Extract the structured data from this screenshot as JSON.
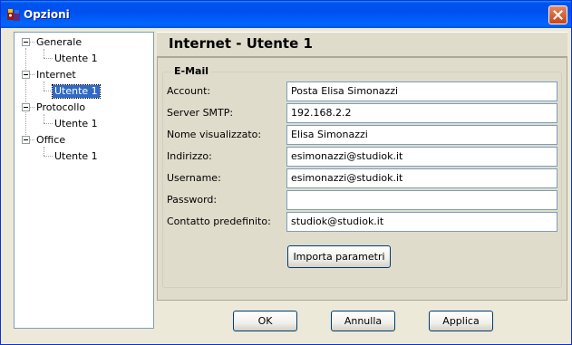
{
  "window": {
    "title": "Opzioni",
    "icon": "app-icon",
    "close_icon": "close-icon"
  },
  "tree": {
    "nodes": [
      {
        "label": "Generale",
        "children": [
          {
            "label": "Utente  1"
          }
        ]
      },
      {
        "label": "Internet",
        "children": [
          {
            "label": "Utente  1",
            "selected": true
          }
        ]
      },
      {
        "label": "Protocollo",
        "children": [
          {
            "label": "Utente  1"
          }
        ]
      },
      {
        "label": "Office",
        "children": [
          {
            "label": "Utente  1"
          }
        ]
      }
    ]
  },
  "panel": {
    "title": "Internet - Utente  1",
    "group_title": "E-Mail",
    "fields": [
      {
        "label": "Account:",
        "value": "Posta Elisa Simonazzi"
      },
      {
        "label": "Server SMTP:",
        "value": "192.168.2.2"
      },
      {
        "label": "Nome visualizzato:",
        "value": "Elisa Simonazzi"
      },
      {
        "label": "Indirizzo:",
        "value": "esimonazzi@studiok.it"
      },
      {
        "label": "Username:",
        "value": "esimonazzi@studiok.it"
      },
      {
        "label": "Password:",
        "value": ""
      },
      {
        "label": "Contatto predefinito:",
        "value": "studiok@studiok.it"
      }
    ],
    "import_button": "Importa parametri"
  },
  "buttons": {
    "ok": "OK",
    "cancel": "Annulla",
    "apply": "Applica"
  },
  "colors": {
    "titlebar": "#0054E3",
    "selection": "#316AC5",
    "panel": "#E0DCCC",
    "dialog": "#ECE9D8"
  }
}
